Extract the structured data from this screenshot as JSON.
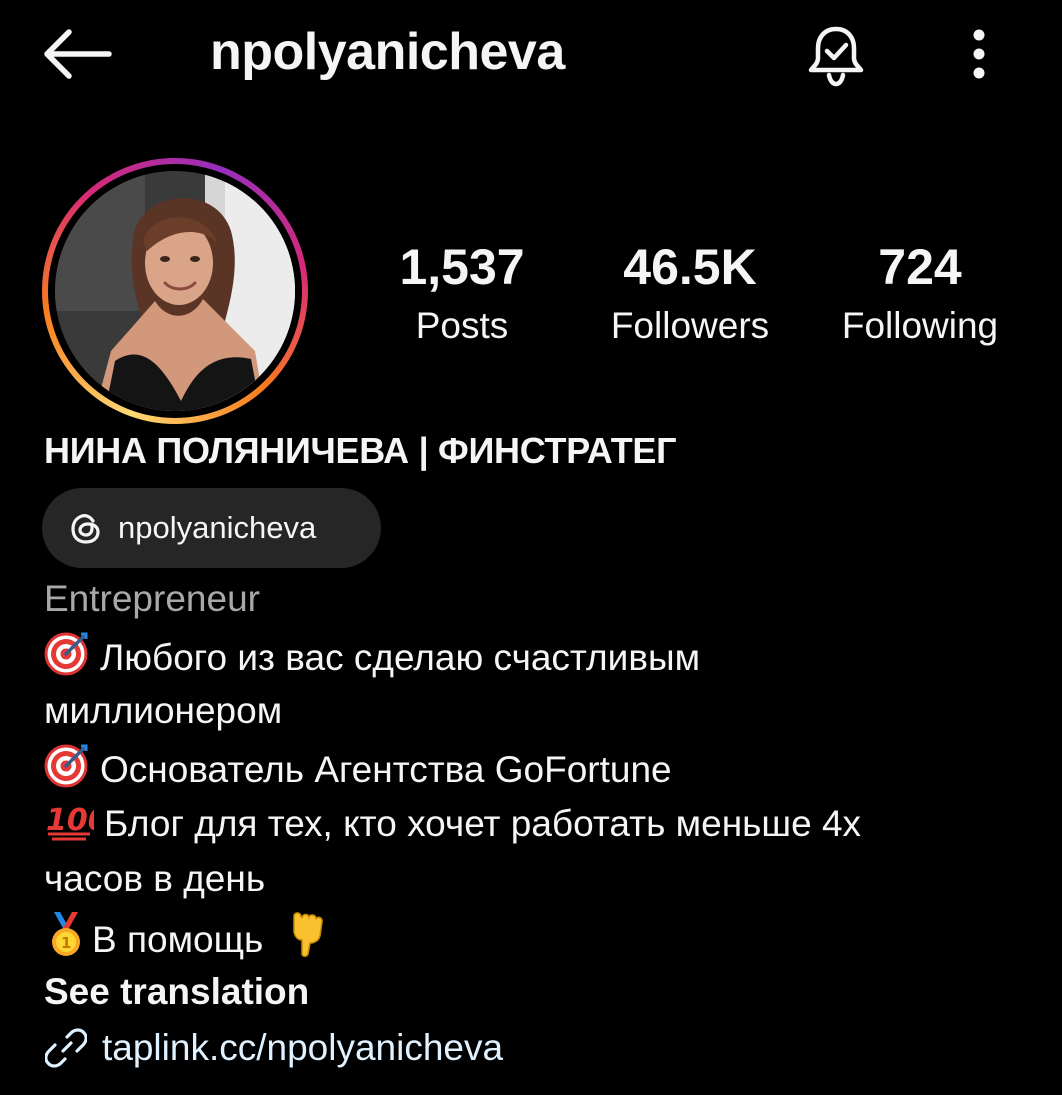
{
  "header": {
    "username": "npolyanicheva",
    "back_icon": "arrow-left-icon",
    "bell_icon": "bell-check-icon",
    "more_icon": "vertical-dots-icon"
  },
  "profile": {
    "avatar_ring_colors": [
      "#feda75",
      "#fa7e1e",
      "#d62976",
      "#962fbf"
    ],
    "stats": {
      "posts": {
        "value": "1,537",
        "label": "Posts"
      },
      "followers": {
        "value": "46.5K",
        "label": "Followers"
      },
      "following": {
        "value": "724",
        "label": "Following"
      }
    },
    "full_name": "НИНА ПОЛЯНИЧЕВА | ФИНСТРАТЕГ",
    "threads_badge": {
      "icon": "threads-icon",
      "handle": "npolyanicheva"
    },
    "category": "Entrepreneur",
    "bio": {
      "line1": "Любого из вас сделаю счастливым",
      "line2": "миллионером",
      "line3": "Основатель Агентства GoFortune",
      "line4": "Блог для тех, кто хочет работать меньше 4х",
      "line5": "часов в день",
      "line6": "В помощь"
    },
    "see_translation": "See translation",
    "link": {
      "icon": "link-icon",
      "text": "taplink.cc/npolyanicheva"
    }
  },
  "colors": {
    "background": "#000000",
    "text_primary": "#f5f5f5",
    "text_secondary": "#a8a8a8",
    "pill_background": "#262626",
    "link_text": "#e0f1ff"
  }
}
